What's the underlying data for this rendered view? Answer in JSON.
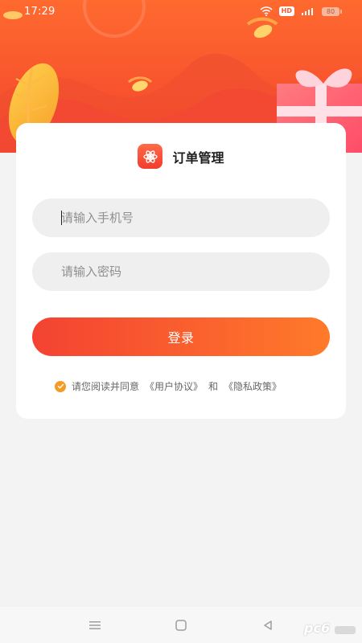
{
  "status_bar": {
    "time": "17:29",
    "network_badge": "HD",
    "battery_level": "80"
  },
  "brand": {
    "title": "订单管理"
  },
  "form": {
    "phone_placeholder": "请输入手机号",
    "password_placeholder": "请输入密码",
    "login_label": "登录"
  },
  "agreement": {
    "prefix": "请您阅读并同意",
    "user_agreement": "《用户协议》",
    "conjunction": "和",
    "privacy_policy": "《隐私政策》"
  },
  "watermark": {
    "text": "pc6"
  },
  "colors": {
    "accent_start": "#f44232",
    "accent_end": "#ff7a2a",
    "hero_red": "#f4462b",
    "check_orange": "#f39c27"
  },
  "icons": {
    "wifi": "wifi-icon",
    "signal": "signal-icon",
    "app": "app-flower-icon",
    "check": "check-icon",
    "menu": "menu-icon",
    "home": "home-icon",
    "back": "back-icon"
  }
}
